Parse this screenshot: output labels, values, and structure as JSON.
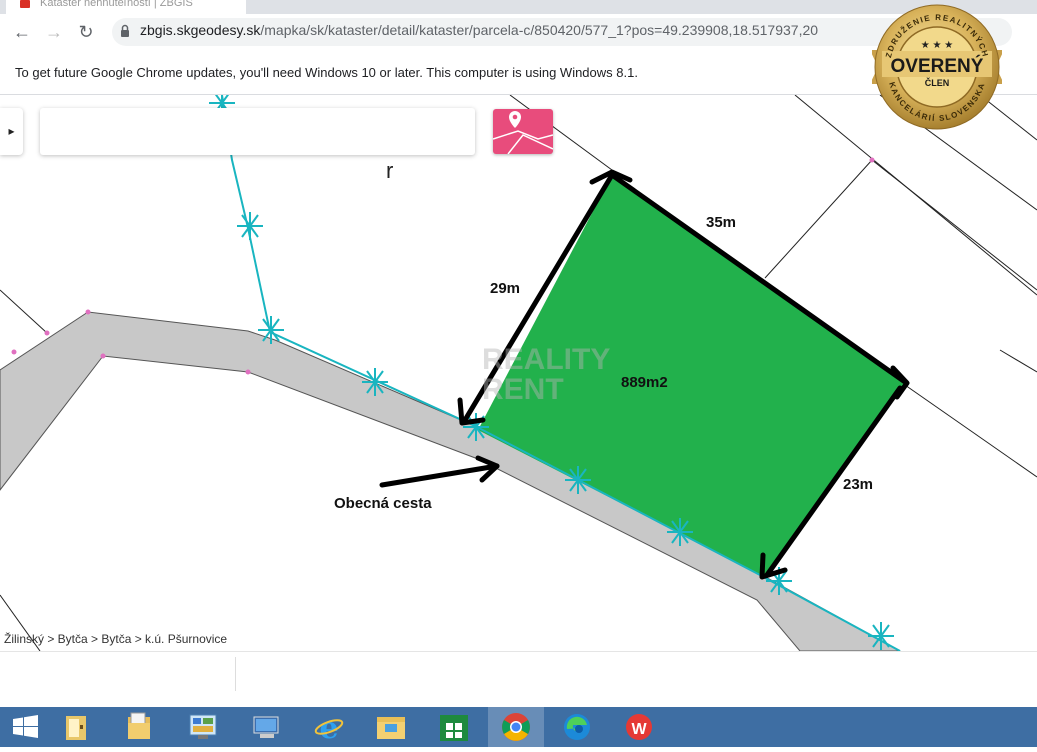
{
  "browser": {
    "tab_title": "Kataster nehnuteľností | ZBGIS",
    "url_host": "zbgis.skgeodesy.sk",
    "url_path": "/mapka/sk/kataster/detail/kataster/parcela-c/850420/577_1?pos=49.239908,18.517937,20",
    "infobar_text": "To get future Google Chrome updates, you'll need Windows 10 or later. This computer is using Windows 8.1."
  },
  "map": {
    "side_label_top": "35m",
    "side_label_left": "29m",
    "side_label_right": "23m",
    "area_label": "889m2",
    "road_label": "Obecná cesta",
    "watermark_line1": "REALITY",
    "watermark_line2": "RENT",
    "breadcrumb": "Žilinský > Bytča > Bytča > k.ú. Pšurnovice",
    "parcel_color": "#22b14c",
    "road_color": "#c8c8c8",
    "boundary_color": "#19b5c0"
  },
  "badge": {
    "top_text": "ZDRUŽENIE REALITNÝCH",
    "main": "OVERENÝ",
    "sub": "ČLEN",
    "bottom_text": "KANCELÁRIÍ SLOVENSKA"
  },
  "taskbar": {
    "items": [
      "windows-start-icon",
      "file-explorer-icon",
      "documents-folder-icon",
      "control-panel-icon",
      "this-pc-icon",
      "internet-explorer-icon",
      "file-folder-icon",
      "store-icon",
      "chrome-icon",
      "edge-icon",
      "wps-office-icon"
    ]
  }
}
